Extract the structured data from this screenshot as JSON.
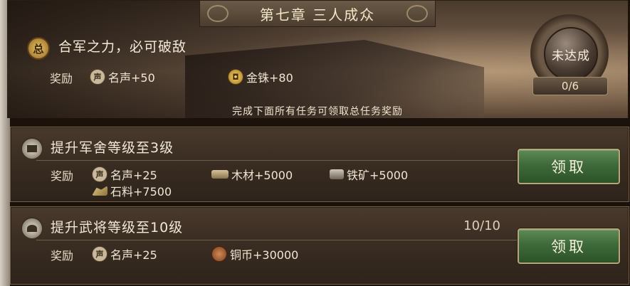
{
  "chapter": {
    "title": "第七章  三人成众",
    "summary_badge": "总",
    "main_task": "合军之力，必可破敌",
    "reward_label": "奖励",
    "rewards": [
      {
        "icon": "fame-icon",
        "badge": "声",
        "text": "名声+50"
      },
      {
        "icon": "gold-coin-icon",
        "badge": "",
        "text": "金铢+80"
      }
    ],
    "status": "未达成",
    "progress": "0/6",
    "hint": "完成下面所有任务可领取总任务奖励"
  },
  "tasks": [
    {
      "title": "提升军舍等级至3级",
      "progress": "",
      "reward_label": "奖励",
      "rewards": [
        {
          "icon": "fame-icon",
          "badge": "声",
          "text": "名声+25"
        },
        {
          "icon": "wood-icon",
          "badge": "",
          "text": "木材+5000"
        },
        {
          "icon": "iron-ore-icon",
          "badge": "",
          "text": "铁矿+5000"
        },
        {
          "icon": "stone-icon",
          "badge": "",
          "text": "石料+7500"
        }
      ],
      "button": "领取"
    },
    {
      "title": "提升武将等级至10级",
      "progress": "10/10",
      "reward_label": "奖励",
      "rewards": [
        {
          "icon": "fame-icon",
          "badge": "声",
          "text": "名声+25"
        },
        {
          "icon": "copper-coin-icon",
          "badge": "",
          "text": "铜币+30000"
        }
      ],
      "button": "领取"
    }
  ]
}
